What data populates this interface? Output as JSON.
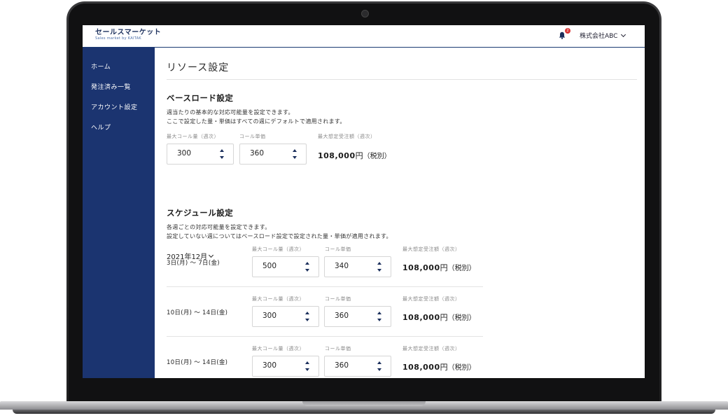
{
  "header": {
    "logo_main": "セールスマーケット",
    "logo_sub": "Sales market by KAITAK",
    "notification_count": "2",
    "account_name": "株式会社ABC"
  },
  "sidebar": {
    "items": [
      {
        "label": "ホーム"
      },
      {
        "label": "発注済み一覧"
      },
      {
        "label": "アカウント設定"
      },
      {
        "label": "ヘルプ"
      }
    ]
  },
  "page": {
    "title": "リソース設定"
  },
  "baseload": {
    "heading": "ベースロード設定",
    "desc1": "週当たりの基本的な対応可能量を設定できます。",
    "desc2": "ここで設定した量・単価はすべての週にデフォルトで適用されます。",
    "label_calls": "最大コール量（週次）",
    "label_price": "コール単価",
    "label_amount": "最大想定受注額（週次）",
    "calls": "300",
    "price": "360",
    "amount": "108,000",
    "yen": "円",
    "tax": "（税別）"
  },
  "schedule": {
    "heading": "スケジュール設定",
    "desc1": "各週ごとの対応可能量を設定できます。",
    "desc2": "設定していない週についてはベースロード設定で設定された量・単価が適用されます。",
    "month": "2021年12月",
    "rows": [
      {
        "period": "3日(月) 〜 7日(金)",
        "label_calls": "最大コール量（週次）",
        "label_price": "コール単価",
        "label_amount": "最大想定受注額（週次）",
        "calls": "500",
        "price": "340",
        "amount": "108,000",
        "yen": "円",
        "tax": "（税別）"
      },
      {
        "period": "10日(月) 〜 14日(金)",
        "label_calls": "最大コール量（週次）",
        "label_price": "コール単価",
        "label_amount": "最大想定受注額（週次）",
        "calls": "300",
        "price": "360",
        "amount": "108,000",
        "yen": "円",
        "tax": "（税別）"
      },
      {
        "period": "10日(月) 〜 14日(金)",
        "label_calls": "最大コール量（週次）",
        "label_price": "コール単価",
        "label_amount": "最大想定受注額（週次）",
        "calls": "300",
        "price": "360",
        "amount": "108,000",
        "yen": "円",
        "tax": "（税別）"
      }
    ]
  },
  "colors": {
    "sidebar": "#1b3470",
    "accent": "#1b2f5c",
    "badge": "#d93838"
  }
}
